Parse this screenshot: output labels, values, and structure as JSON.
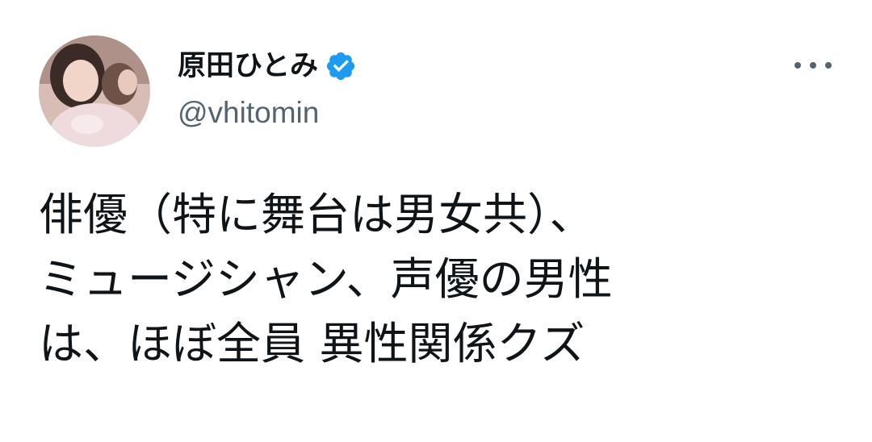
{
  "tweet": {
    "author": {
      "display_name": "原田ひとみ",
      "handle": "@vhitomin",
      "verified": true
    },
    "more_icon": "more-horizontal-icon",
    "text_lines": [
      "俳優（特に舞台は男女共）、",
      "ミュージシャン、声優の男性",
      "は、ほぼ全員 異性関係クズ"
    ]
  },
  "colors": {
    "text_primary": "#0f1419",
    "text_secondary": "#536471",
    "verified_blue": "#1d9bf0",
    "background": "#ffffff"
  }
}
